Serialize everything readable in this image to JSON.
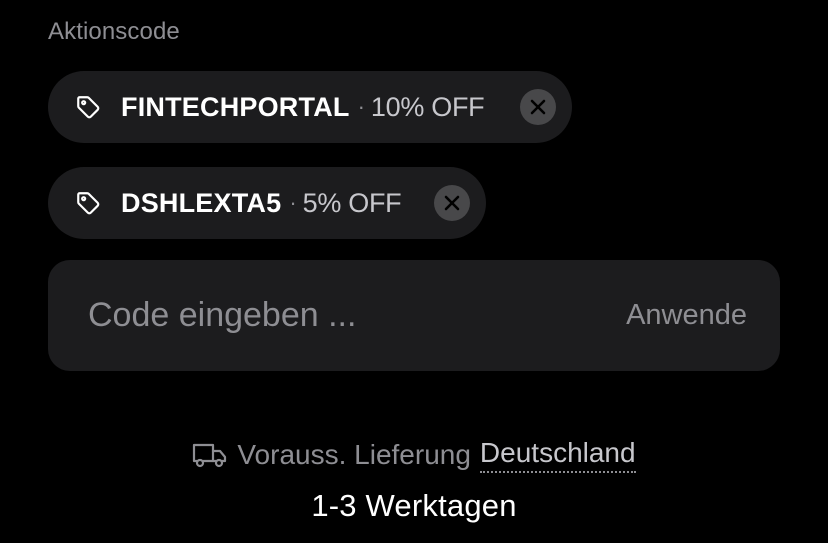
{
  "promo": {
    "section_label": "Aktionscode",
    "applied_codes": [
      {
        "code": "FINTECHPORTAL",
        "separator": "·",
        "discount": "10% OFF",
        "icon": "tag-icon",
        "remove_icon": "close-icon"
      },
      {
        "code": "DSHLEXTA5",
        "separator": "·",
        "discount": "5% OFF",
        "icon": "tag-icon",
        "remove_icon": "close-icon"
      }
    ],
    "input": {
      "value": "",
      "placeholder": "Code eingeben ..."
    },
    "apply_label": "Anwende"
  },
  "delivery": {
    "icon": "truck-icon",
    "label": "Vorauss. Lieferung",
    "country": "Deutschland",
    "time": "1-3 Werktagen"
  },
  "colors": {
    "background": "#000000",
    "surface": "#1c1c1e",
    "muted_text": "#8e8e93",
    "primary_text": "#ffffff",
    "remove_button": "#48484a"
  }
}
